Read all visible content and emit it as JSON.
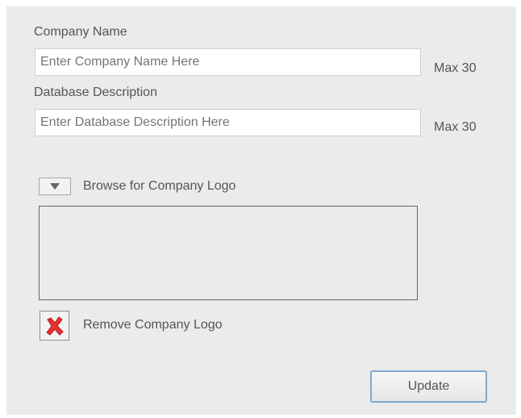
{
  "form": {
    "company_name": {
      "label": "Company Name",
      "placeholder": "Enter Company Name Here",
      "max_note": "Max 30"
    },
    "database_description": {
      "label": "Database Description",
      "placeholder": "Enter Database Description Here",
      "max_note": "Max 30"
    },
    "logo": {
      "browse_label": "Browse for Company Logo",
      "browse_icon": "triangle-down-icon",
      "remove_label": "Remove Company Logo",
      "remove_icon": "red-x-icon"
    },
    "update_label": "Update"
  },
  "colors": {
    "panel_background": "#ebebeb",
    "text": "#555555",
    "remove_icon": "#e8312f",
    "update_border": "#7fa9cf"
  }
}
